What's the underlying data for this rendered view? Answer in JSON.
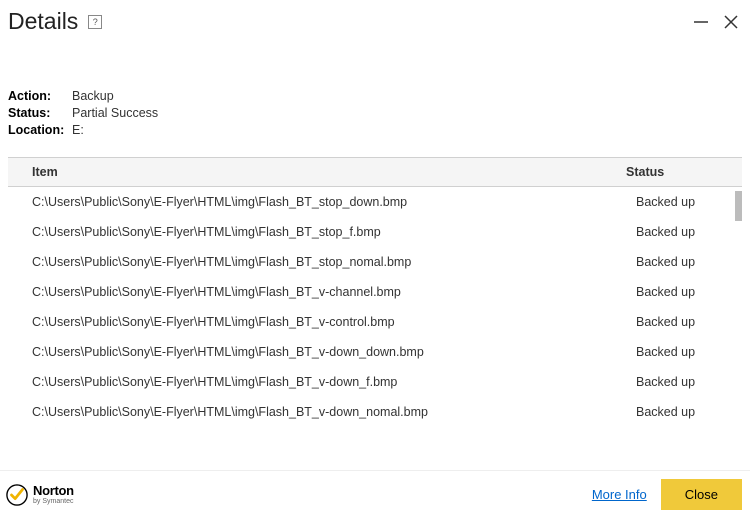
{
  "window": {
    "title": "Details",
    "help": "?"
  },
  "meta": {
    "labels": {
      "action": "Action:",
      "status": "Status:",
      "location": "Location:"
    },
    "values": {
      "action": "Backup",
      "status": "Partial Success",
      "location": "E:"
    }
  },
  "table": {
    "headers": {
      "item": "Item",
      "status": "Status"
    },
    "rows": [
      {
        "item": "C:\\Users\\Public\\Sony\\E-Flyer\\HTML\\img\\Flash_BT_stop_down.bmp",
        "status": "Backed up"
      },
      {
        "item": "C:\\Users\\Public\\Sony\\E-Flyer\\HTML\\img\\Flash_BT_stop_f.bmp",
        "status": "Backed up"
      },
      {
        "item": "C:\\Users\\Public\\Sony\\E-Flyer\\HTML\\img\\Flash_BT_stop_nomal.bmp",
        "status": "Backed up"
      },
      {
        "item": "C:\\Users\\Public\\Sony\\E-Flyer\\HTML\\img\\Flash_BT_v-channel.bmp",
        "status": "Backed up"
      },
      {
        "item": "C:\\Users\\Public\\Sony\\E-Flyer\\HTML\\img\\Flash_BT_v-control.bmp",
        "status": "Backed up"
      },
      {
        "item": "C:\\Users\\Public\\Sony\\E-Flyer\\HTML\\img\\Flash_BT_v-down_down.bmp",
        "status": "Backed up"
      },
      {
        "item": "C:\\Users\\Public\\Sony\\E-Flyer\\HTML\\img\\Flash_BT_v-down_f.bmp",
        "status": "Backed up"
      },
      {
        "item": "C:\\Users\\Public\\Sony\\E-Flyer\\HTML\\img\\Flash_BT_v-down_nomal.bmp",
        "status": "Backed up"
      }
    ]
  },
  "footer": {
    "brand_name": "Norton",
    "brand_sub": "by Symantec",
    "more_info": "More Info",
    "close": "Close"
  }
}
